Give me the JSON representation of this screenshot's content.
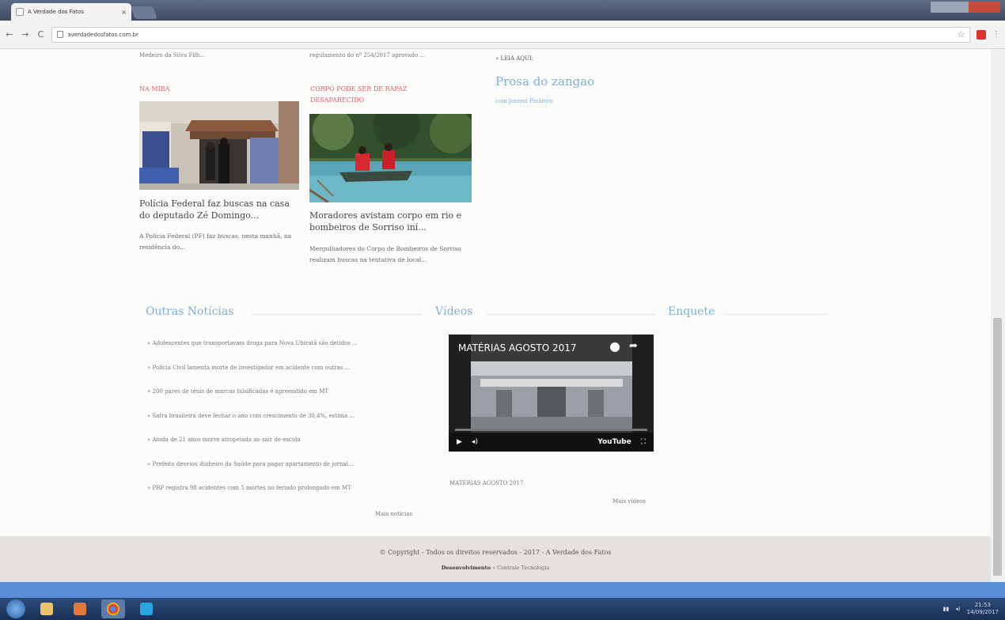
{
  "browser": {
    "tab_title": "A Verdade dos Fatos",
    "tab_close": "×",
    "url": "averdadedosfatos.com.br",
    "back": "←",
    "forward": "→",
    "reload": "C",
    "star": "☆",
    "menu": "⋮"
  },
  "top_snippets": {
    "left": "Medeiro da Silva Filh...",
    "middle": "regulamento do nº 254/2017 aprovado ...",
    "right_label": "» LEIA AQUI:"
  },
  "articles": [
    {
      "kicker": "NA MIRA",
      "headline": "Polícia Federal faz buscas na casa do deputado Zé Domingo...",
      "summary": "A Polícia Federal (PF) faz buscas, nesta manhã, na residência do..."
    },
    {
      "kicker": "CORPO PODE SER DE RAPAZ DESAPARECIDO",
      "headline": "Moradores avistam corpo em rio e bombeiros de Sorriso iní...",
      "summary": "Mergulhadores do Corpo de Bombeiros de Sorriso realizam buscas na tentativa de local..."
    }
  ],
  "column": {
    "title": "Prosa do zangao",
    "author": "com Josemi Pinheiro"
  },
  "sections": {
    "news_title": "Outras Notícias",
    "videos_title": "Vídeos",
    "poll_title": "Enquete"
  },
  "news_list": [
    "» Adolescentes que transportavam droga para Nova Ubiratã são detidos ...",
    "» Polícia Civil lamenta morte de investigador em acidente com outras ...",
    "» 200 pares de tênis de marcas falsificadas é apreendido em MT",
    "» Safra brasileira deve fechar o ano com crescimento de 30,4%, estima ...",
    "» Ainda de 21 anos morre atropelada ao sair de escola",
    "» Prefeito desviou dinheiro da Saúde para pagar apartamento de jornal...",
    "» PRF registra 98 acidentes com 5 mortes no feriado prolongado em MT"
  ],
  "news_more": "Mais notícias",
  "video": {
    "title": "MATÉRIAS AGOSTO 2017",
    "caption": "MATÉRIAS AGOSTO 2017",
    "more": "Mais vídeos",
    "play": "▶",
    "volume": "◂)",
    "brand": "YouTube",
    "fullscreen": "⛶",
    "share": "➦"
  },
  "footer": {
    "copyright": "© Copyright - Todos os direitos reservados - 2017 - A Verdade dos Fatos",
    "dev_label": "Desenvolvimento",
    "dev_by": "» Centrale Tecnologia"
  },
  "taskbar": {
    "time": "21:53",
    "date": "14/09/2017",
    "apps": [
      "explorer",
      "media",
      "chrome",
      "skype"
    ]
  },
  "colors": {
    "accent_blue": "#7fb0d8",
    "kicker_red": "#e05a6a",
    "footer_bg": "#e6e1dc"
  }
}
